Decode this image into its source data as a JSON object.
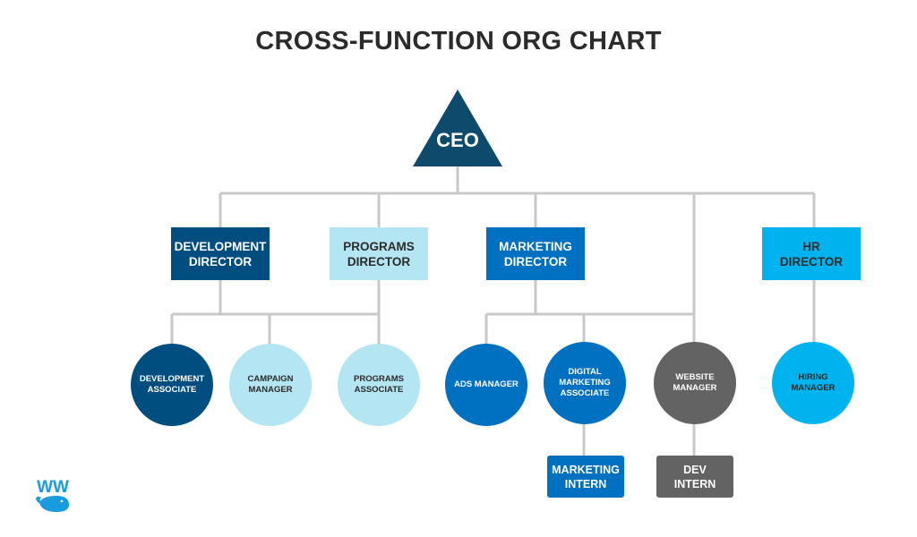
{
  "title": "CROSS-FUNCTION ORG CHART",
  "colors": {
    "navy": "#0d4a6b",
    "dark_blue": "#004d80",
    "light_blue": "#b3e5f2",
    "mid_blue": "#0070c0",
    "cyan": "#00b3ef",
    "gray": "#636363",
    "connector": "#c8c8c8",
    "text_dark": "#2b2b2b"
  },
  "ceo": {
    "label": "CEO"
  },
  "directors": [
    {
      "id": "development",
      "line1": "DEVELOPMENT",
      "line2": "DIRECTOR"
    },
    {
      "id": "programs",
      "line1": "PROGRAMS",
      "line2": "DIRECTOR"
    },
    {
      "id": "marketing",
      "line1": "MARKETING",
      "line2": "DIRECTOR"
    },
    {
      "id": "hr",
      "line1": "HR",
      "line2": "DIRECTOR"
    }
  ],
  "staff": [
    {
      "id": "development-associate",
      "lines": [
        "DEVELOPMENT",
        "ASSOCIATE"
      ]
    },
    {
      "id": "campaign-manager",
      "lines": [
        "CAMPAIGN",
        "MANAGER"
      ]
    },
    {
      "id": "programs-associate",
      "lines": [
        "PROGRAMS",
        "ASSOCIATE"
      ]
    },
    {
      "id": "ads-manager",
      "lines": [
        "ADS MANAGER"
      ]
    },
    {
      "id": "digital-marketing-associate",
      "lines": [
        "DIGITAL",
        "MARKETING",
        "ASSOCIATE"
      ]
    },
    {
      "id": "website-manager",
      "lines": [
        "WEBSITE",
        "MANAGER"
      ]
    },
    {
      "id": "hiring-manager",
      "lines": [
        "HIRING",
        "MANAGER"
      ]
    }
  ],
  "interns": [
    {
      "id": "marketing-intern",
      "line1": "MARKETING",
      "line2": "INTERN"
    },
    {
      "id": "dev-intern",
      "line1": "DEV",
      "line2": "INTERN"
    }
  ],
  "logo": {
    "name": "whale-logo",
    "text": "WW"
  }
}
